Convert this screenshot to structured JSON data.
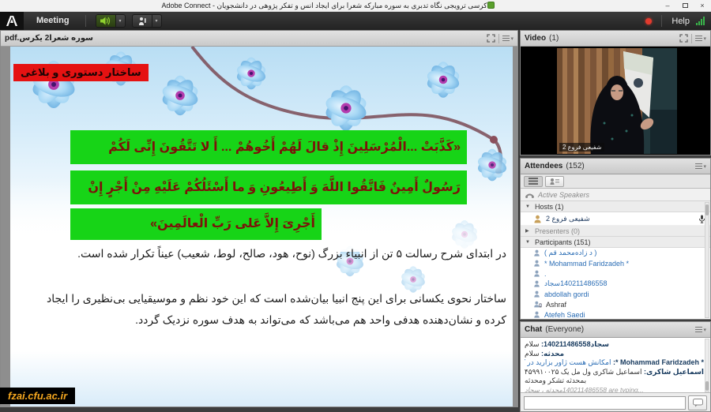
{
  "window": {
    "title": "کرسی ترویجی نگاه تدبری به سوره مبارکه شعرا برای ایجاد انس و تفکر پژوهی در دانشجویان - Adobe Connect",
    "minimize": "–",
    "close": "×"
  },
  "menubar": {
    "meeting": "Meeting",
    "help": "Help"
  },
  "share_pod": {
    "title": "سوره شعرا2 یکرس.pdf",
    "slide": {
      "banner_title": "ساختار دستوری و بلاغی",
      "verse_line1": "«کَذَّبَتْ ...الْمُرْسَلِینَ إِذْ قالَ لَهُمْ أَخُوهُمْ ... أَ لا تَتَّقُونَ إِنِّی لَکُمْ",
      "verse_line2": "رَسُولٌ أَمِینٌ فَاتَّقُوا اللَّهَ وَ أَطِیعُونِ وَ ما أَسْئَلُکُمْ عَلَیْهِ مِنْ أَجْرٍ إِنْ",
      "verse_line3": "أَجْرِیَ إِلاَّ عَلی رَبِّ الْعالَمِینَ»",
      "paragraph1": "در ابتدای شرح رسالت ۵ تن از انبیاء بزرگ (نوح، هود، صالح، لوط، شعیب) عیناً تکرار شده است.",
      "paragraph2": "ساختار نحوی یکسانی برای این پنج انبیا بیان‌شده است که این خود نظم و موسیقیایی بی‌نظیری را ایجاد کرده و نشان‌دهنده هدفی واحد هم می‌باشد که می‌تواند به هدف سوره نزدیک گردد."
    }
  },
  "watermark": "fzai.cfu.ac.ir",
  "video_pod": {
    "title": "Video",
    "count": "(1)",
    "name_tag": "شفیعی فروع 2"
  },
  "attendees_pod": {
    "title": "Attendees",
    "count": "(152)",
    "active_speakers": "Active Speakers",
    "hosts_label": "Hosts (1)",
    "host_name": "شفیعی فروع 2",
    "presenters_label": "Presenters (0)",
    "participants_label": "Participants (151)",
    "participants": [
      {
        "name": "( د زاده‌محمد قم )"
      },
      {
        "name": "* Mohammad Faridzadeh *"
      },
      {
        "name": "."
      },
      {
        "name": "سجاد‎140211486558"
      },
      {
        "name": "abdollah gordi"
      },
      {
        "name": "Ashraf"
      },
      {
        "name": "Atefeh Saedi"
      }
    ]
  },
  "chat_pod": {
    "title": "Chat",
    "scope": "(Everyone)",
    "messages": [
      {
        "name": "سجاد‎140211486558:",
        "text": "سلام"
      },
      {
        "name": "محدثه:",
        "text": "سلام"
      },
      {
        "name": "* Mohammad Faridzadeh *:",
        "text": "امکانش هست ژاور بزارید در کانال آهمون میدم ؟"
      },
      {
        "name": "اسماعیل شاکری:",
        "text": "اسماعیل شاکری ول مل یک ۵۴۵۹۹۱۰۰۲۵"
      },
      {
        "name": "",
        "text": "بمحدثه تشکر ومحدثه"
      }
    ],
    "typing": "محدثه ، سجاد‎140211486558 are typing..."
  }
}
